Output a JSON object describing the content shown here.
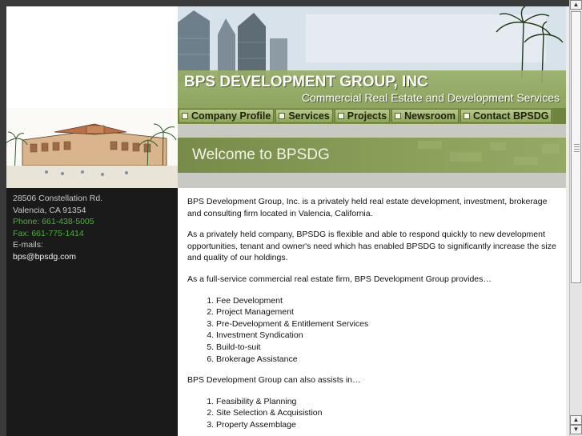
{
  "header": {
    "title": "BPS DEVELOPMENT GROUP, INC",
    "subtitle": "Commercial Real Estate and Development Services"
  },
  "nav": {
    "items": [
      {
        "label": "Company Profile"
      },
      {
        "label": "Services"
      },
      {
        "label": "Projects"
      },
      {
        "label": "Newsroom"
      },
      {
        "label": "Contact BPSDG"
      }
    ]
  },
  "banner": {
    "welcome": "Welcome to BPSDG"
  },
  "contact": {
    "address": "28506 Constellation Rd.",
    "city": "Valencia, CA 91354",
    "phone": "Phone: 661-438-5005",
    "fax": "Fax: 661-775-1414",
    "emails_label": "E-mails:",
    "email": "bps@bpsdg.com"
  },
  "content": {
    "p1": "BPS Development Group, Inc. is a privately held real estate development, investment, brokerage and consulting firm located in Valencia, California.",
    "p2": "As a privately held company, BPSDG is flexible and able to respond quickly to new development opportunities, tenant and owner's need which has enabled BPSDG to significantly increase the size and quality of our holdings.",
    "p3": "As a full-service commercial real estate firm, BPS Development Group provides…",
    "list1": [
      "Fee Development",
      "Project Management",
      "Pre-Development & Entitlement Services",
      "Investment Syndication",
      "Build-to-suit",
      "Brokerage Assistance"
    ],
    "p4": "BPS Development Group can also assists in…",
    "list2": [
      "Feasibility & Planning",
      "Site Selection & Acquisistion",
      "Property Assemblage"
    ]
  },
  "colors": {
    "accent_green": "#86a052",
    "contact_green": "#4caf3a",
    "sidebar_bg": "#1a1a1a"
  }
}
